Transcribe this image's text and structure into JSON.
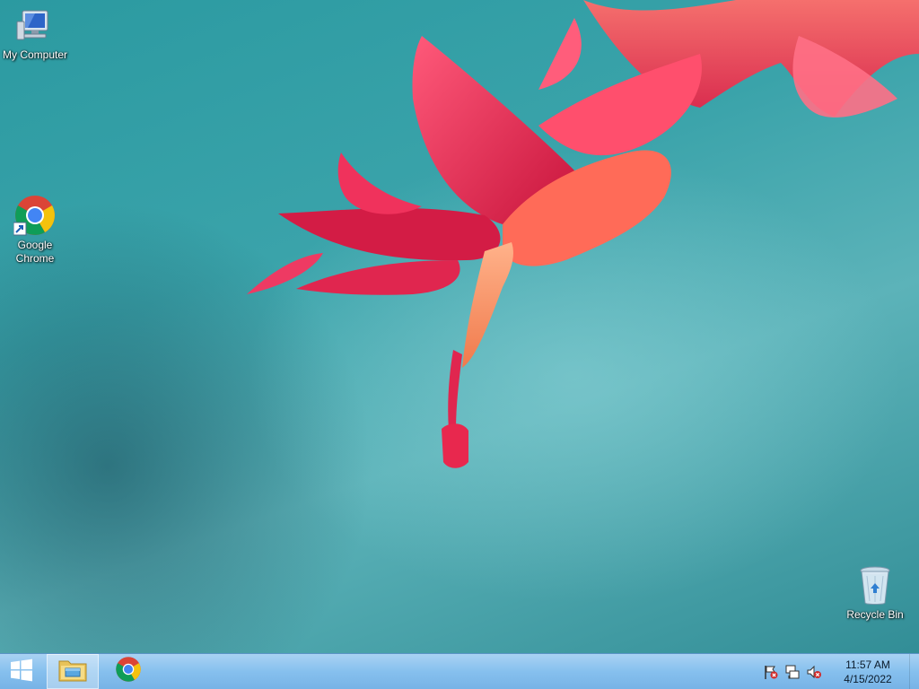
{
  "desktop": {
    "icons": [
      {
        "label": "My Computer",
        "icon": "computer-icon"
      },
      {
        "label": "Google\nChrome",
        "label_line1": "Google",
        "label_line2": "Chrome",
        "icon": "chrome-icon"
      },
      {
        "label": "Recycle Bin",
        "icon": "recycle-bin-icon"
      }
    ],
    "wallpaper": "pink-cactus-flower-on-teal"
  },
  "taskbar": {
    "start_icon": "windows-logo-icon",
    "pinned": [
      {
        "name": "File Explorer",
        "icon": "file-explorer-icon",
        "active": true
      },
      {
        "name": "Google Chrome",
        "icon": "chrome-icon",
        "active": false
      }
    ],
    "tray": {
      "icons": [
        "action-center-flag-icon",
        "network-icon",
        "volume-muted-icon"
      ],
      "time": "11:57 AM",
      "date": "4/15/2022"
    }
  },
  "colors": {
    "taskbar": "#86c0ee",
    "wallpaper_teal": "#3aa3aa",
    "flower_pink": "#e8284e"
  }
}
